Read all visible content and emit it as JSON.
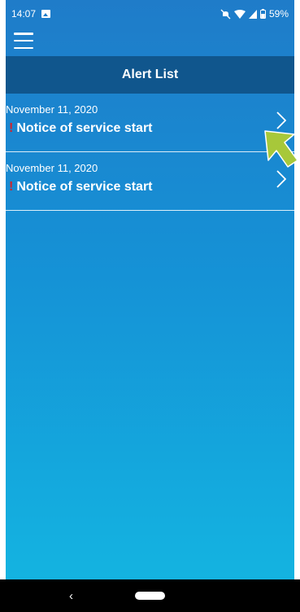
{
  "status_bar": {
    "time": "14:07",
    "battery_percent": "59%",
    "icons": [
      "image-icon",
      "mute-icon",
      "wifi-icon",
      "signal-icon",
      "battery-icon"
    ]
  },
  "app": {
    "menu_icon": "hamburger-menu-icon",
    "title": "Alert List"
  },
  "alerts": [
    {
      "date": "November 11, 2020",
      "mark": "!",
      "title": "Notice of service start"
    },
    {
      "date": "November 11, 2020",
      "mark": "!",
      "title": "Notice of service start"
    }
  ],
  "nav_bar": {
    "back_label": "‹"
  },
  "colors": {
    "header": "#10568d",
    "background_top": "#1f7cc9",
    "background_bottom": "#14b7e2",
    "alert_mark": "#d2232a",
    "pointer": "#a7c83a"
  }
}
